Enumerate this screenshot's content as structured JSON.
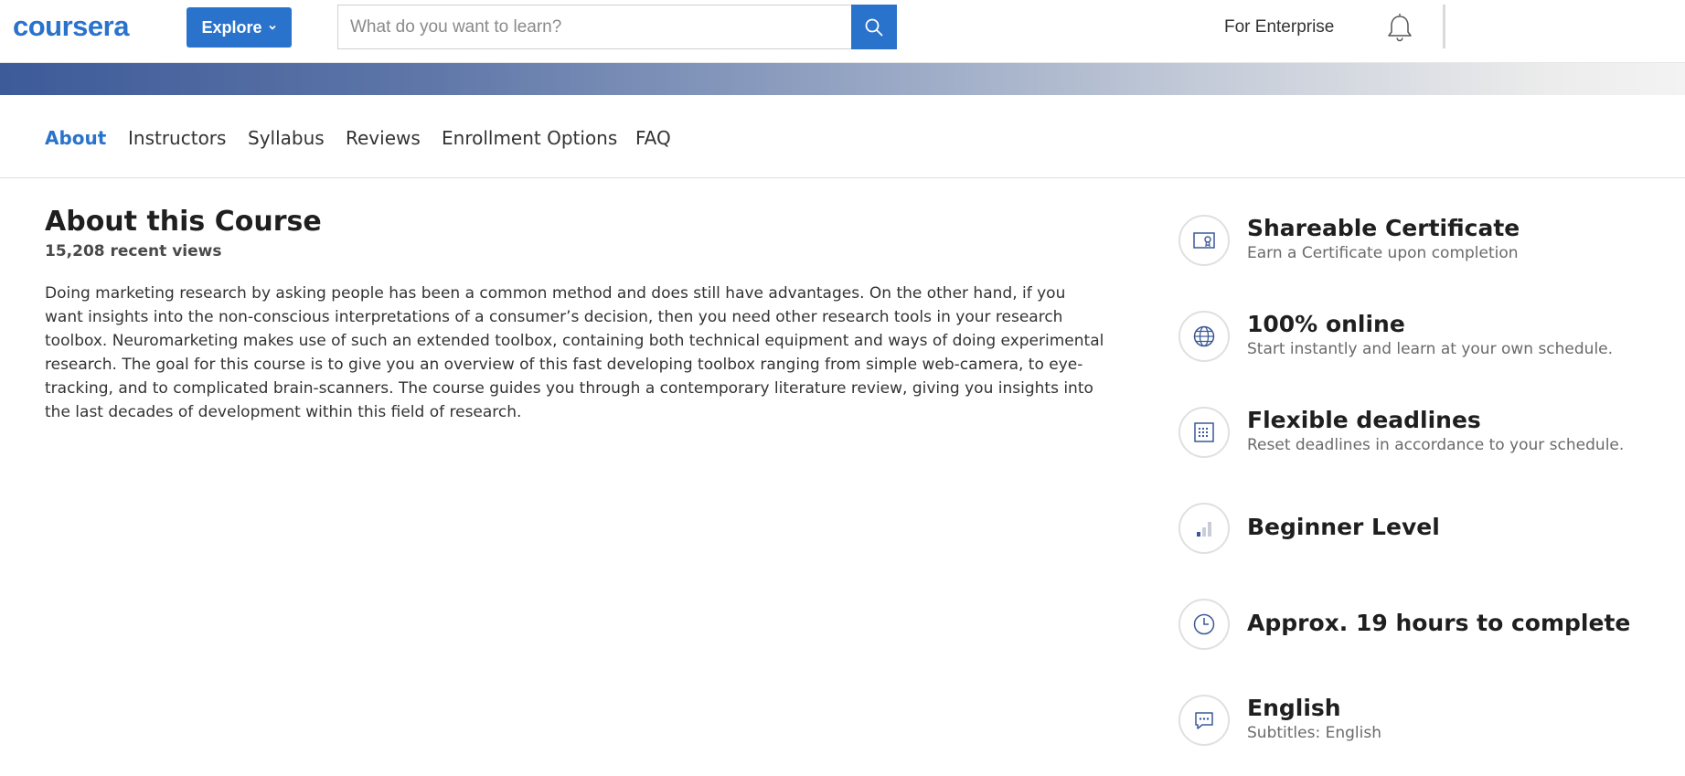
{
  "header": {
    "logo_text": "coursera",
    "explore_label": "Explore",
    "search_placeholder": "What do you want to learn?",
    "enterprise_label": "For Enterprise"
  },
  "subnav": {
    "items": [
      {
        "label": "About",
        "active": true
      },
      {
        "label": "Instructors"
      },
      {
        "label": "Syllabus"
      },
      {
        "label": "Reviews"
      },
      {
        "label": "Enrollment Options"
      },
      {
        "label": "FAQ"
      }
    ]
  },
  "about": {
    "title": "About this Course",
    "views": "15,208 recent views",
    "description": "Doing marketing research by asking people has been a common method and does still have advantages. On the other hand, if you want insights into the non-conscious interpretations of a consumer’s decision, then you need other research tools in your research toolbox. Neuromarketing makes use of such an extended toolbox, containing both technical equipment and ways of doing experimental research. The goal for this course is to give you an overview of this fast developing toolbox ranging from simple web-camera, to eye-tracking, and to complicated brain-scanners. The course guides you through a contemporary literature review, giving you insights into the last decades of development  within this field of research."
  },
  "features": [
    {
      "icon": "certificate-icon",
      "title": "Shareable Certificate",
      "subtitle": "Earn a Certificate upon completion"
    },
    {
      "icon": "globe-icon",
      "title": "100% online",
      "subtitle": "Start instantly and learn at your own schedule."
    },
    {
      "icon": "calendar-icon",
      "title": "Flexible deadlines",
      "subtitle": "Reset deadlines in accordance to your schedule."
    },
    {
      "icon": "level-bars-icon",
      "title": "Beginner Level",
      "subtitle": ""
    },
    {
      "icon": "clock-icon",
      "title": "Approx. 19 hours to complete",
      "subtitle": ""
    },
    {
      "icon": "chat-bubble-icon",
      "title": "English",
      "subtitle": "Subtitles: English"
    }
  ],
  "colors": {
    "brand_blue": "#2a73cc",
    "icon_navy": "#3b5898"
  }
}
